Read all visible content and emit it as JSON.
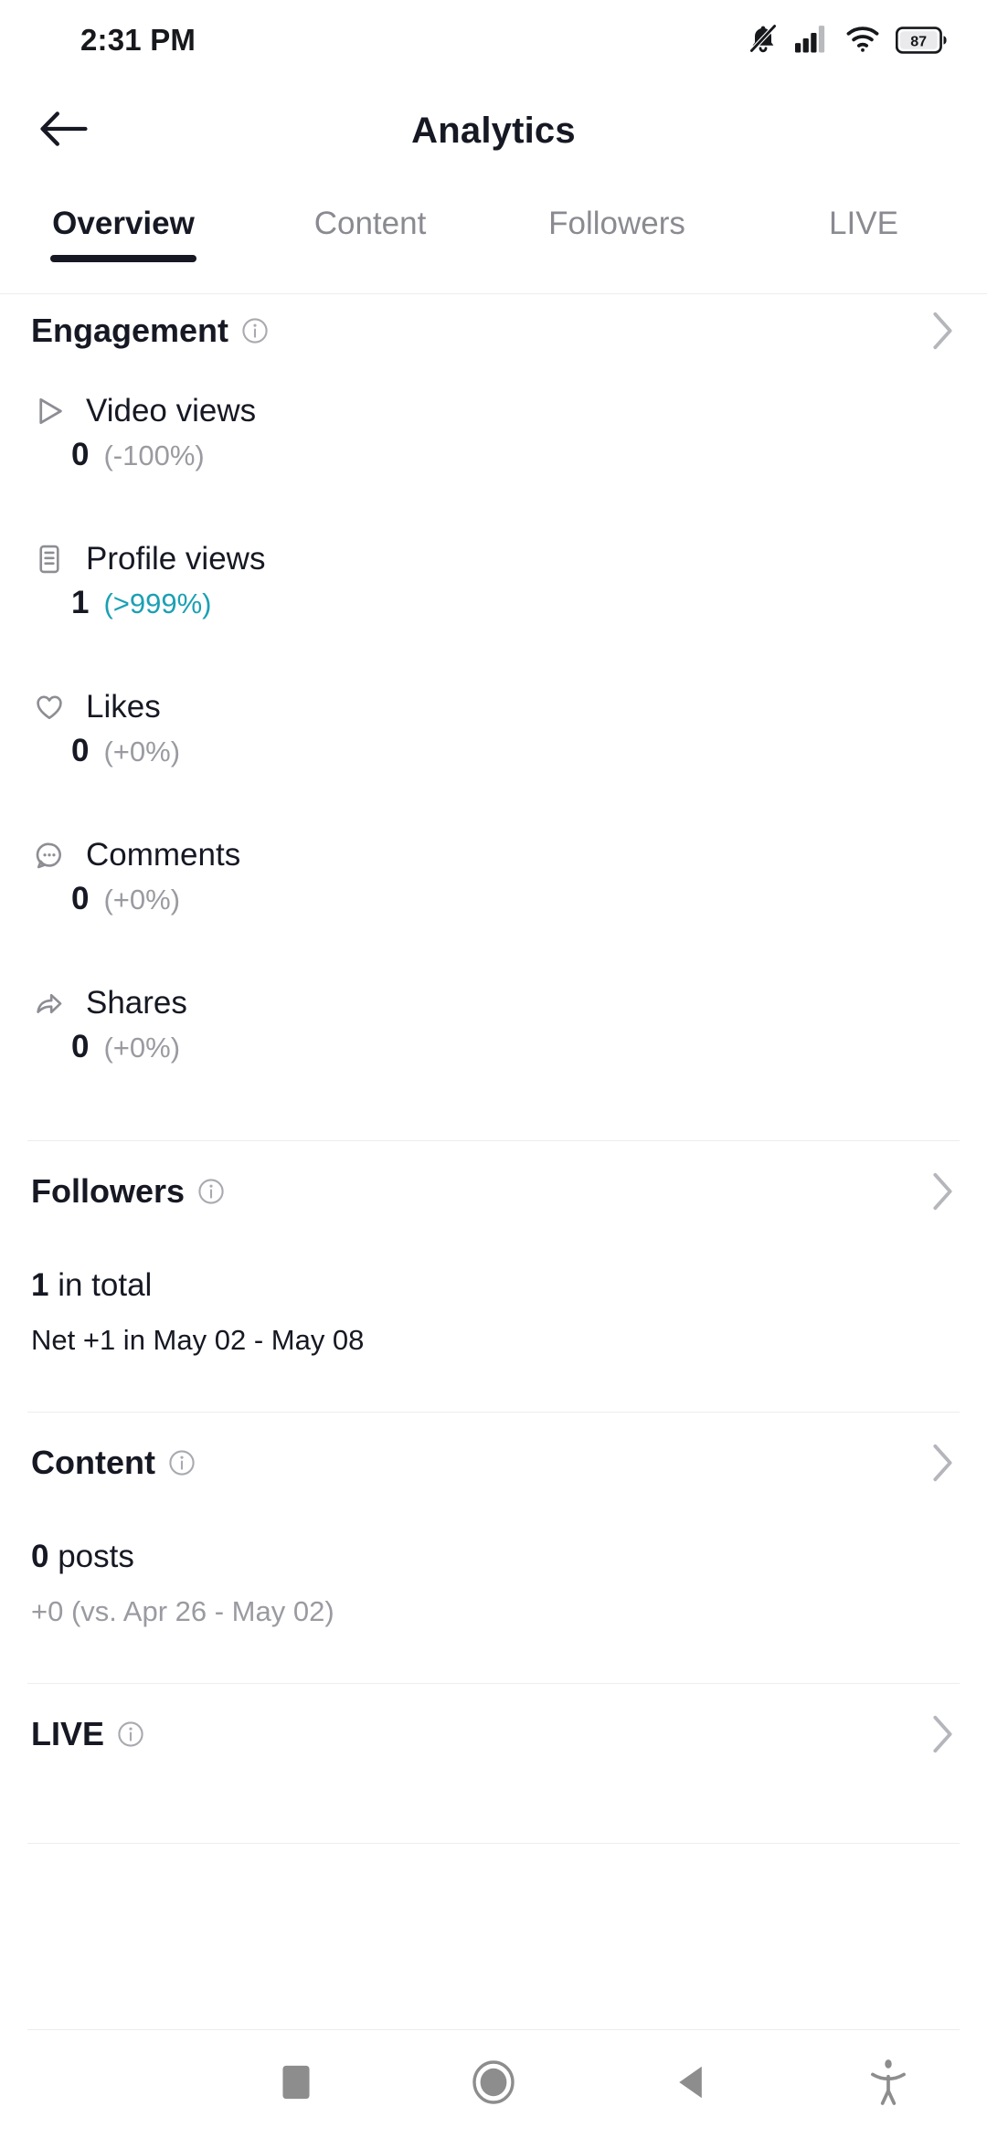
{
  "status_bar": {
    "time": "2:31 PM",
    "icons": [
      "bell-muted-icon",
      "signal-icon",
      "wifi-icon",
      "battery-icon"
    ],
    "battery_level": "87"
  },
  "header": {
    "back_label": "back-arrow",
    "title": "Analytics"
  },
  "tabs": [
    {
      "label": "Overview",
      "active": true
    },
    {
      "label": "Content",
      "active": false
    },
    {
      "label": "Followers",
      "active": false
    },
    {
      "label": "LIVE",
      "active": false
    }
  ],
  "sections": {
    "engagement": {
      "title": "Engagement",
      "metrics": [
        {
          "icon": "play-icon",
          "label": "Video views",
          "value": "0",
          "delta": "(-100%)",
          "positive": false
        },
        {
          "icon": "profile-icon",
          "label": "Profile views",
          "value": "1",
          "delta": "(>999%)",
          "positive": true
        },
        {
          "icon": "heart-icon",
          "label": "Likes",
          "value": "0",
          "delta": "(+0%)",
          "positive": false
        },
        {
          "icon": "comment-icon",
          "label": "Comments",
          "value": "0",
          "delta": "(+0%)",
          "positive": false
        },
        {
          "icon": "share-icon",
          "label": "Shares",
          "value": "0",
          "delta": "(+0%)",
          "positive": false
        }
      ]
    },
    "followers": {
      "title": "Followers",
      "total_value": "1",
      "total_suffix": " in total",
      "net": "Net +1 in May 02 - May 08"
    },
    "content": {
      "title": "Content",
      "posts_value": "0",
      "posts_suffix": " posts",
      "comparison": "+0 (vs. Apr 26 - May 02)"
    },
    "live": {
      "title": "LIVE"
    }
  },
  "nav_bar": {
    "items": [
      "recents-square-icon",
      "home-circle-icon",
      "back-triangle-icon",
      "accessibility-icon"
    ]
  },
  "colors": {
    "text": "#161823",
    "muted": "#9a9ba1",
    "positive": "#1ba0b3",
    "divider": "#ededee",
    "nav_icon": "#8d8d8d"
  }
}
